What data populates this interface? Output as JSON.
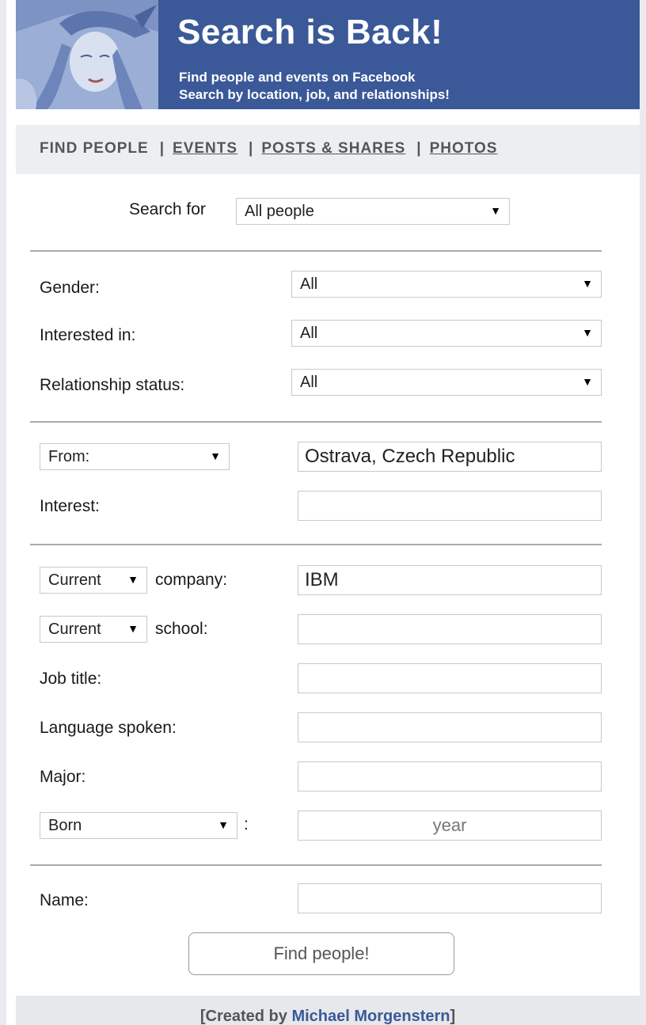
{
  "header": {
    "title": "Search is Back!",
    "subtitle_line1": "Find people and events on Facebook",
    "subtitle_line2": "Search by location, job, and relationships!"
  },
  "nav": {
    "items": [
      {
        "label": "FIND PEOPLE",
        "current": true
      },
      {
        "label": "EVENTS",
        "current": false
      },
      {
        "label": "POSTS & SHARES",
        "current": false
      },
      {
        "label": "PHOTOS",
        "current": false
      }
    ],
    "separator": "|"
  },
  "search_for": {
    "label": "Search for",
    "value": "All people"
  },
  "filters": {
    "gender": {
      "label": "Gender:",
      "value": "All"
    },
    "interested_in": {
      "label": "Interested in:",
      "value": "All"
    },
    "relationship_status": {
      "label": "Relationship status:",
      "value": "All"
    }
  },
  "location": {
    "from_select": "From:",
    "from_value": "Ostrava, Czech Republic",
    "interest_label": "Interest:",
    "interest_value": ""
  },
  "work": {
    "company_select": "Current",
    "company_label": "company:",
    "company_value": "IBM",
    "school_select": "Current",
    "school_label": "school:",
    "school_value": "",
    "job_title_label": "Job title:",
    "language_label": "Language spoken:",
    "major_label": "Major:",
    "born_select": "Born",
    "born_colon": ":",
    "year_placeholder": "year"
  },
  "name": {
    "label": "Name:",
    "value": ""
  },
  "submit": {
    "label": "Find people!"
  },
  "footer": {
    "prefix": "[Created by ",
    "author": "Michael Morgenstern",
    "suffix": "]"
  },
  "colors": {
    "brand_blue": "#3b5998",
    "nav_bg": "#eceef2",
    "rule": "#aaaaaa"
  },
  "icons": {
    "dropdown": "triangle-down-icon"
  }
}
